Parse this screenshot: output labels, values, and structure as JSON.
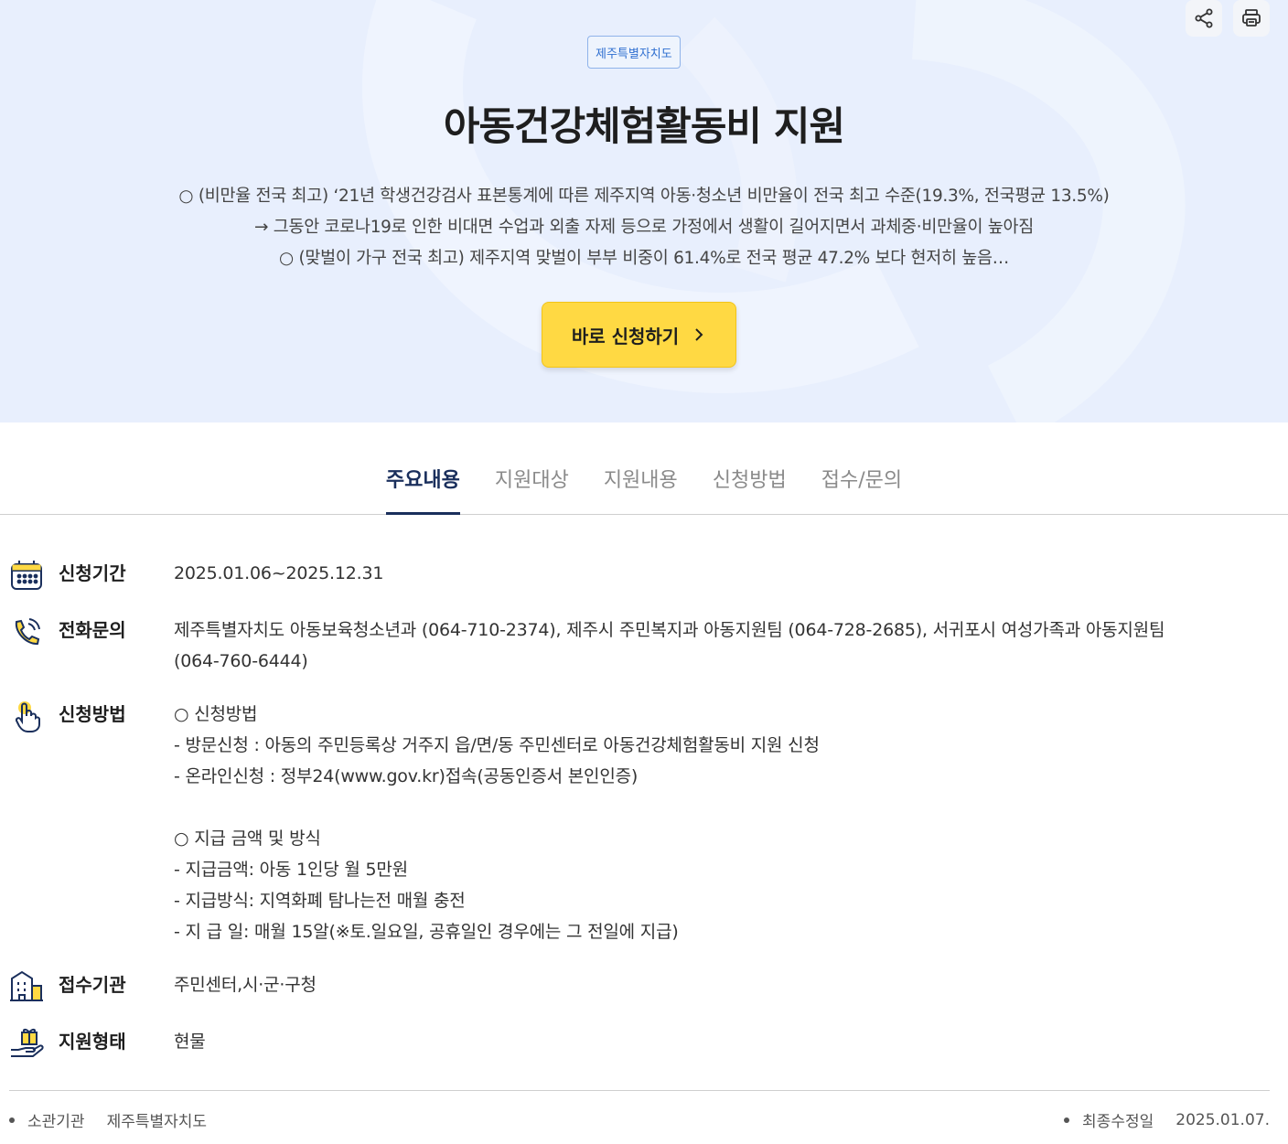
{
  "hero": {
    "org_badge": "제주특별자치도",
    "title": "아동건강체험활동비 지원",
    "description": [
      "○ (비만율 전국 최고) ‘21년 학생건강검사 표본통계에 따른 제주지역 아동·청소년 비만율이 전국 최고 수준(19.3%, 전국평균 13.5%)",
      "→ 그동안 코로나19로 인한 비대면 수업과 외출 자제 등으로 가정에서 생활이 길어지면서 과체중·비만율이 높아짐",
      "○ (맞벌이 가구 전국 최고) 제주지역 맞벌이 부부 비중이 61.4%로 전국 평균 47.2% 보다 현저히 높음…"
    ],
    "apply_label": "바로 신청하기"
  },
  "tabs": [
    {
      "label": "주요내용",
      "active": true
    },
    {
      "label": "지원대상",
      "active": false
    },
    {
      "label": "지원내용",
      "active": false
    },
    {
      "label": "신청방법",
      "active": false
    },
    {
      "label": "접수/문의",
      "active": false
    }
  ],
  "info": {
    "period": {
      "label": "신청기간",
      "value": "2025.01.06~2025.12.31"
    },
    "phone": {
      "label": "전화문의",
      "lines": [
        "제주특별자치도 아동보육청소년과 (064-710-2374), 제주시 주민복지과 아동지원팀 (064-728-2685), 서귀포시 여성가족과 아동지원팀",
        "(064-760-6444)"
      ]
    },
    "method": {
      "label": "신청방법",
      "lines": [
        "○ 신청방법",
        "- 방문신청 : 아동의 주민등록상 거주지 읍/면/동 주민센터로 아동건강체험활동비 지원 신청",
        "- 온라인신청 : 정부24(www.gov.kr)접속(공동인증서 본인인증)",
        "",
        "○ 지급 금액 및 방식",
        "- 지급금액: 아동 1인당 월 5만원",
        "- 지급방식: 지역화폐 탐나는전 매월 충전",
        "- 지 급 일: 매월 15알(※토.일요일, 공휴일인 경우에는 그 전일에 지급)"
      ]
    },
    "agency": {
      "label": "접수기관",
      "value": "주민센터,시·군·구청"
    },
    "support_type": {
      "label": "지원형태",
      "value": "현물"
    }
  },
  "footer": {
    "org_key": "소관기관",
    "org_value": "제주특별자치도",
    "updated_key": "최종수정일",
    "updated_value": "2025.01.07."
  },
  "icons": {
    "share": "share-icon",
    "print": "print-icon",
    "calendar": "calendar-icon",
    "phone": "phone-icon",
    "hand": "pointer-hand-icon",
    "building": "building-icon",
    "gift": "gift-hand-icon"
  },
  "colors": {
    "hero_bg": "#e8effd",
    "accent_yellow": "#ffd943",
    "navy": "#1a2f5c",
    "badge_blue": "#2f6fd0"
  }
}
